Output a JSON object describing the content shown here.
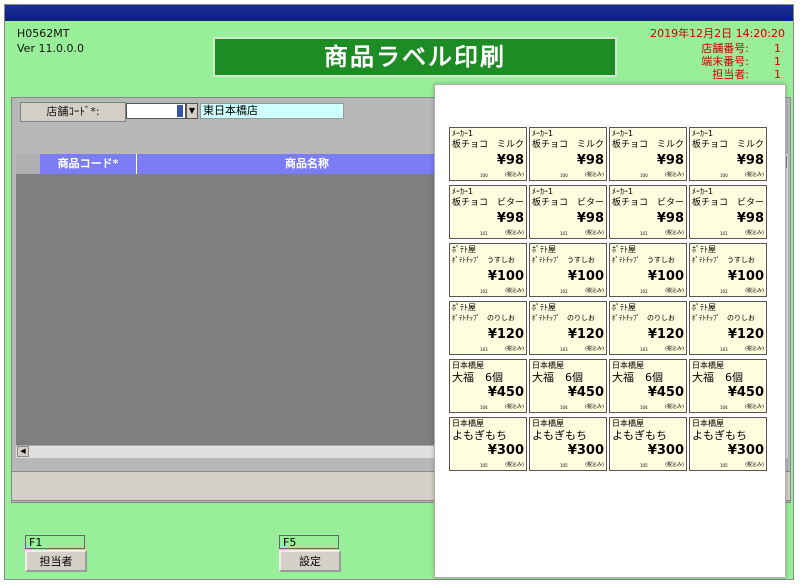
{
  "header": {
    "program_id": "H0562MT",
    "version": "Ver 11.0.0.0",
    "title": "商品ラベル印刷",
    "datetime": "2019年12月2日 14:20:20",
    "info": [
      {
        "label": "店舗番号:",
        "value": "1"
      },
      {
        "label": "端末番号:",
        "value": "1"
      },
      {
        "label": "担当者:",
        "value": "1"
      }
    ]
  },
  "store": {
    "label": "店舗ｺｰﾄﾞ*:",
    "code": "1",
    "name": "東日本橋店"
  },
  "grid": {
    "columns": [
      "商品コード*",
      "商品名称"
    ]
  },
  "function_keys": [
    {
      "key": "F1",
      "label": "担当者"
    },
    {
      "key": "F5",
      "label": "設定"
    }
  ],
  "preview": {
    "labels": [
      {
        "maker": "ﾒｰｶｰ1",
        "name": "板チョコ　ミルク",
        "price": "¥98",
        "code": "100",
        "tax": "(税込み)",
        "size": "normal"
      },
      {
        "maker": "ﾒｰｶｰ1",
        "name": "板チョコ　ミルク",
        "price": "¥98",
        "code": "100",
        "tax": "(税込み)",
        "size": "normal"
      },
      {
        "maker": "ﾒｰｶｰ1",
        "name": "板チョコ　ミルク",
        "price": "¥98",
        "code": "100",
        "tax": "(税込み)",
        "size": "normal"
      },
      {
        "maker": "ﾒｰｶｰ1",
        "name": "板チョコ　ミルク",
        "price": "¥98",
        "code": "100",
        "tax": "(税込み)",
        "size": "normal"
      },
      {
        "maker": "ﾒｰｶｰ1",
        "name": "板チョコ　ビター",
        "price": "¥98",
        "code": "101",
        "tax": "(税込み)",
        "size": "normal"
      },
      {
        "maker": "ﾒｰｶｰ1",
        "name": "板チョコ　ビター",
        "price": "¥98",
        "code": "101",
        "tax": "(税込み)",
        "size": "normal"
      },
      {
        "maker": "ﾒｰｶｰ1",
        "name": "板チョコ　ビター",
        "price": "¥98",
        "code": "101",
        "tax": "(税込み)",
        "size": "normal"
      },
      {
        "maker": "ﾒｰｶｰ1",
        "name": "板チョコ　ビター",
        "price": "¥98",
        "code": "101",
        "tax": "(税込み)",
        "size": "normal"
      },
      {
        "maker": "ﾎﾟﾃﾄ屋",
        "name": "ﾎﾟﾃﾄﾁｯﾌﾟ　うすしお",
        "price": "¥100",
        "code": "102",
        "tax": "(税込み)",
        "size": "tiny"
      },
      {
        "maker": "ﾎﾟﾃﾄ屋",
        "name": "ﾎﾟﾃﾄﾁｯﾌﾟ　うすしお",
        "price": "¥100",
        "code": "102",
        "tax": "(税込み)",
        "size": "tiny"
      },
      {
        "maker": "ﾎﾟﾃﾄ屋",
        "name": "ﾎﾟﾃﾄﾁｯﾌﾟ　うすしお",
        "price": "¥100",
        "code": "102",
        "tax": "(税込み)",
        "size": "tiny"
      },
      {
        "maker": "ﾎﾟﾃﾄ屋",
        "name": "ﾎﾟﾃﾄﾁｯﾌﾟ　うすしお",
        "price": "¥100",
        "code": "102",
        "tax": "(税込み)",
        "size": "tiny"
      },
      {
        "maker": "ﾎﾟﾃﾄ屋",
        "name": "ﾎﾟﾃﾄﾁｯﾌﾟ　のりしお",
        "price": "¥120",
        "code": "103",
        "tax": "(税込み)",
        "size": "tiny"
      },
      {
        "maker": "ﾎﾟﾃﾄ屋",
        "name": "ﾎﾟﾃﾄﾁｯﾌﾟ　のりしお",
        "price": "¥120",
        "code": "103",
        "tax": "(税込み)",
        "size": "tiny"
      },
      {
        "maker": "ﾎﾟﾃﾄ屋",
        "name": "ﾎﾟﾃﾄﾁｯﾌﾟ　のりしお",
        "price": "¥120",
        "code": "103",
        "tax": "(税込み)",
        "size": "tiny"
      },
      {
        "maker": "ﾎﾟﾃﾄ屋",
        "name": "ﾎﾟﾃﾄﾁｯﾌﾟ　のりしお",
        "price": "¥120",
        "code": "103",
        "tax": "(税込み)",
        "size": "tiny"
      },
      {
        "maker": "日本橋屋",
        "name": "大福　6個",
        "price": "¥450",
        "code": "104",
        "tax": "(税込み)",
        "size": "big"
      },
      {
        "maker": "日本橋屋",
        "name": "大福　6個",
        "price": "¥450",
        "code": "104",
        "tax": "(税込み)",
        "size": "big"
      },
      {
        "maker": "日本橋屋",
        "name": "大福　6個",
        "price": "¥450",
        "code": "104",
        "tax": "(税込み)",
        "size": "big"
      },
      {
        "maker": "日本橋屋",
        "name": "大福　6個",
        "price": "¥450",
        "code": "104",
        "tax": "(税込み)",
        "size": "big"
      },
      {
        "maker": "日本橋屋",
        "name": "よもぎもち",
        "price": "¥300",
        "code": "105",
        "tax": "(税込み)",
        "size": "big"
      },
      {
        "maker": "日本橋屋",
        "name": "よもぎもち",
        "price": "¥300",
        "code": "105",
        "tax": "(税込み)",
        "size": "big"
      },
      {
        "maker": "日本橋屋",
        "name": "よもぎもち",
        "price": "¥300",
        "code": "105",
        "tax": "(税込み)",
        "size": "big"
      },
      {
        "maker": "日本橋屋",
        "name": "よもぎもち",
        "price": "¥300",
        "code": "105",
        "tax": "(税込み)",
        "size": "big"
      }
    ]
  },
  "colors": {
    "window_bg": "#99ee99",
    "banner": "#1e8c24",
    "grid_header": "#7c7cf4",
    "info_text": "#cc0000",
    "label_bg": "#fffde0"
  }
}
